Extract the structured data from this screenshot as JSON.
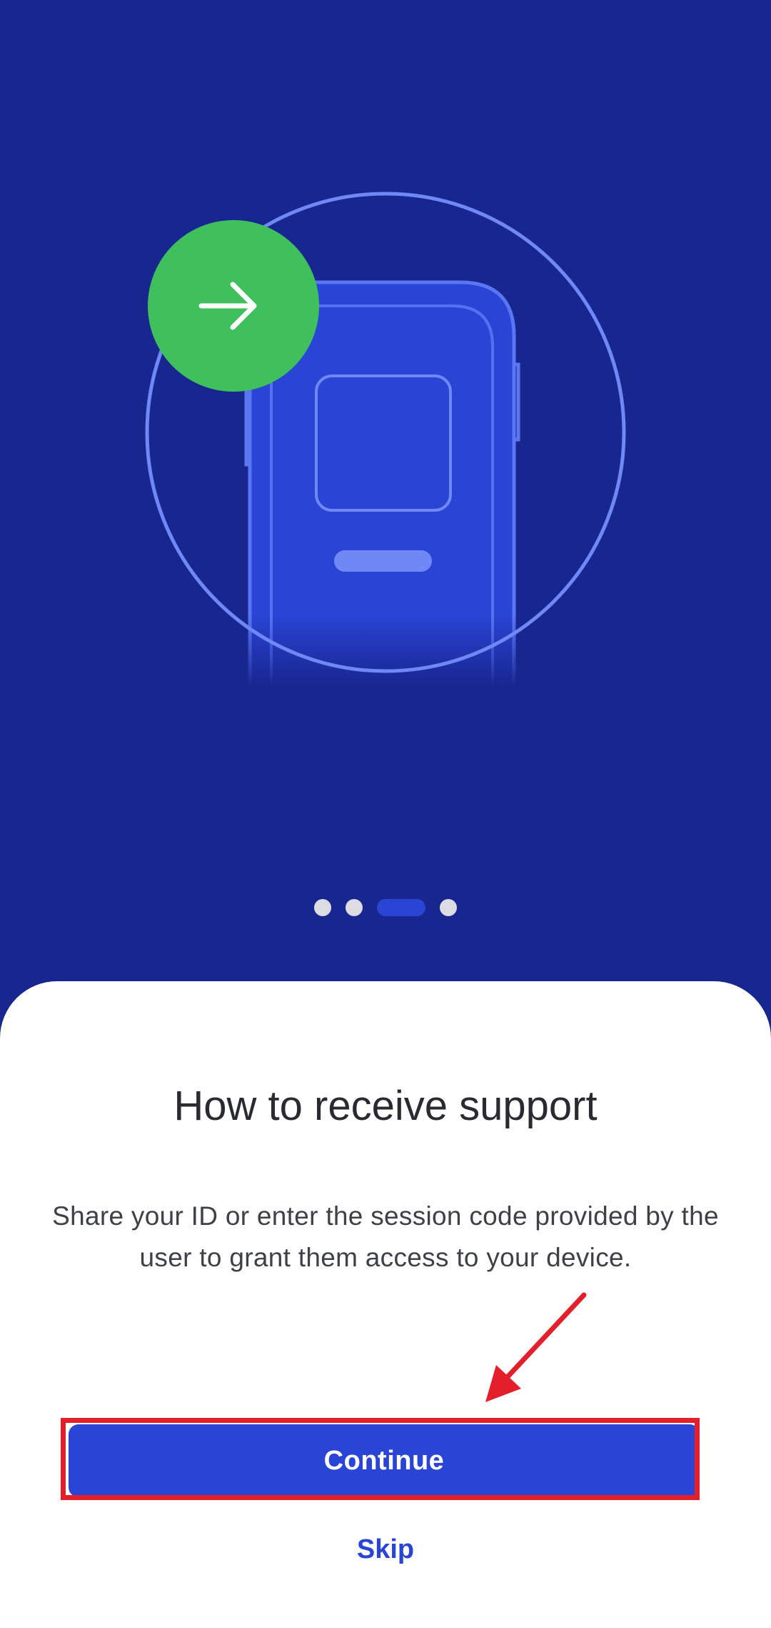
{
  "onboarding": {
    "pager": {
      "total": 4,
      "active_index": 3
    },
    "title": "How to receive support",
    "description": "Share your ID or enter the session code provided by the user to grant them access to your device.",
    "continue_label": "Continue",
    "skip_label": "Skip"
  },
  "colors": {
    "hero_background": "#182690",
    "accent": "#2a45d6",
    "success_green": "#3fc05c",
    "annotation_red": "#e21f2a"
  },
  "icons": {
    "badge": "arrow-right-icon",
    "device": "phone-icon"
  }
}
